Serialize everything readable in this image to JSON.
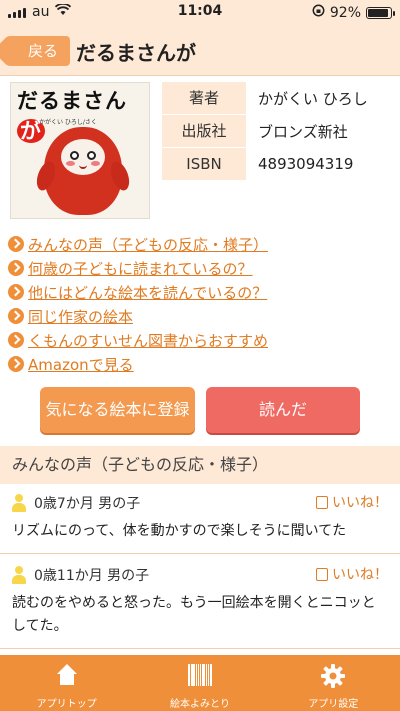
{
  "status_bar": {
    "carrier": "au",
    "time": "11:04",
    "battery": "92%",
    "battery_level": 0.92
  },
  "nav": {
    "back_label": "戻る",
    "title": "だるまさんが"
  },
  "book": {
    "cover_title": "だるまさん",
    "cover_title_tail": "が",
    "cover_author": "かがくい ひろし/さく",
    "info": [
      {
        "label": "著者",
        "value": "かがくい ひろし"
      },
      {
        "label": "出版社",
        "value": "ブロンズ新社"
      },
      {
        "label": "ISBN",
        "value": "4893094319"
      }
    ]
  },
  "links": [
    "みんなの声（子どもの反応・様子）",
    "何歳の子どもに読まれているの？",
    "他にはどんな絵本を読んでいるの？",
    "同じ作家の絵本",
    "くもんのすいせん図書からおすすめ",
    "Amazonで見る"
  ],
  "actions": {
    "register": "気になる絵本に登録",
    "read": "読んだ"
  },
  "voices": {
    "header": "みんなの声（子どもの反応・様子）",
    "items": [
      {
        "who": "0歳7か月 男の子",
        "like": "いいね！",
        "comment": "リズムにのって、体を動かすので楽しそうに聞いてた"
      },
      {
        "who": "0歳11か月 男の子",
        "like": "いいね！",
        "comment": "読むのをやめると怒った。もう一回絵本を開くとニコッとしてた。"
      }
    ]
  },
  "tabs": [
    {
      "label": "アプリトップ",
      "icon": "home-icon"
    },
    {
      "label": "絵本よみとり",
      "icon": "barcode-icon"
    },
    {
      "label": "アプリ設定",
      "icon": "gear-icon"
    }
  ]
}
